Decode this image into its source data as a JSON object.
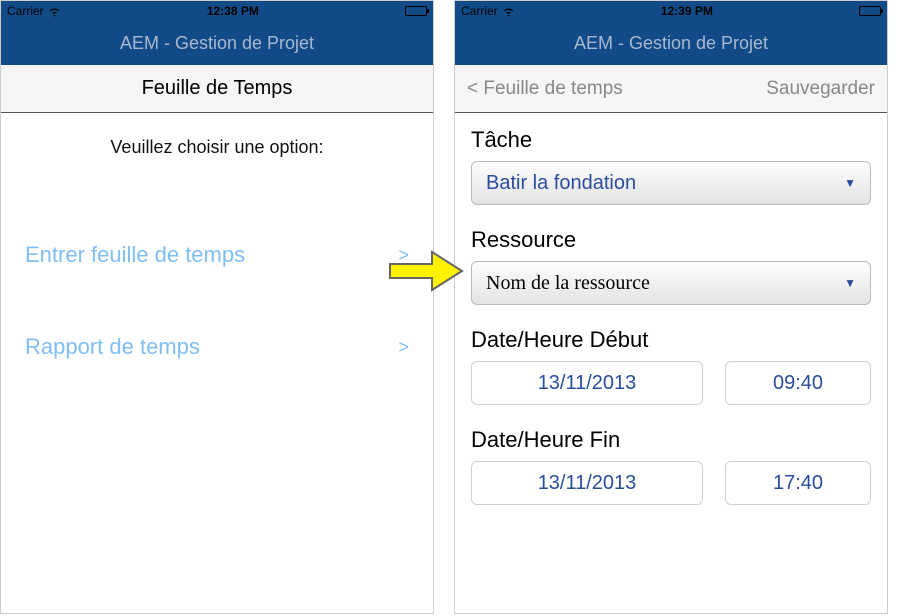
{
  "left": {
    "status": {
      "carrier": "Carrier",
      "time": "12:38 PM"
    },
    "nav_title": "AEM - Gestion de Projet",
    "toolbar_title": "Feuille de Temps",
    "prompt": "Veuillez choisir une option:",
    "menu": [
      {
        "label": "Entrer feuille de temps",
        "chev": ">"
      },
      {
        "label": "Rapport de temps",
        "chev": ">"
      }
    ]
  },
  "right": {
    "status": {
      "carrier": "Carrier",
      "time": "12:39 PM"
    },
    "nav_title": "AEM - Gestion de Projet",
    "back_label": "<  Feuille de temps",
    "save_label": "Sauvegarder",
    "task_label": "Tâche",
    "task_value": "Batir la fondation",
    "resource_label": "Ressource",
    "resource_value": "Nom de la ressource",
    "start_label": "Date/Heure Début",
    "start_date": "13/11/2013",
    "start_time": "09:40",
    "end_label": "Date/Heure Fin",
    "end_date": "13/11/2013",
    "end_time": "17:40",
    "caret": "▼"
  }
}
